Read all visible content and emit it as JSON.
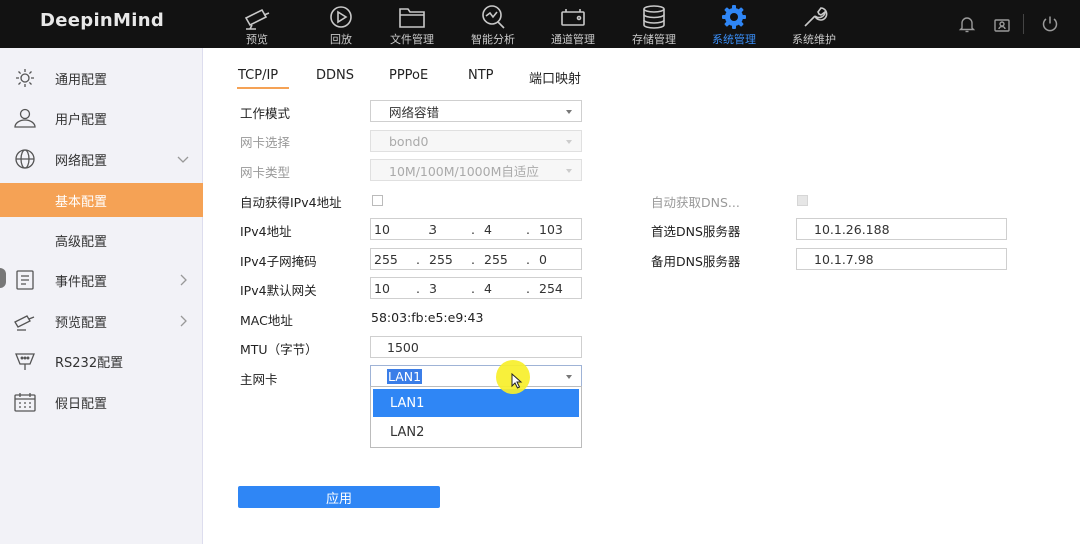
{
  "app": {
    "logo": "DeepinMind"
  },
  "nav": [
    {
      "label": "预览",
      "icon": "camera-icon"
    },
    {
      "label": "回放",
      "icon": "playback-icon"
    },
    {
      "label": "文件管理",
      "icon": "folder-icon"
    },
    {
      "label": "智能分析",
      "icon": "analysis-icon"
    },
    {
      "label": "通道管理",
      "icon": "channel-icon"
    },
    {
      "label": "存储管理",
      "icon": "storage-icon"
    },
    {
      "label": "系统管理",
      "icon": "gear-icon",
      "active": true
    },
    {
      "label": "系统维护",
      "icon": "wrench-icon"
    }
  ],
  "sidebar": {
    "items": [
      {
        "label": "通用配置",
        "icon": "settings-icon"
      },
      {
        "label": "用户配置",
        "icon": "user-icon"
      },
      {
        "label": "网络配置",
        "icon": "globe-icon",
        "expanded": true
      },
      {
        "label": "基本配置",
        "sub": true,
        "active": true
      },
      {
        "label": "高级配置",
        "sub": true
      },
      {
        "label": "事件配置",
        "icon": "event-icon"
      },
      {
        "label": "预览配置",
        "icon": "preview-icon"
      },
      {
        "label": "RS232配置",
        "icon": "serial-icon"
      },
      {
        "label": "假日配置",
        "icon": "calendar-icon"
      }
    ]
  },
  "tabs": [
    {
      "label": "TCP/IP",
      "active": true
    },
    {
      "label": "DDNS"
    },
    {
      "label": "PPPoE"
    },
    {
      "label": "NTP"
    },
    {
      "label": "端口映射"
    }
  ],
  "form": {
    "work_mode_label": "工作模式",
    "work_mode_value": "网络容错",
    "nic_select_label": "网卡选择",
    "nic_select_value": "bond0",
    "nic_type_label": "网卡类型",
    "nic_type_value": "10M/100M/1000M自适应",
    "auto_ipv4_label": "自动获得IPv4地址",
    "ipv4_addr_label": "IPv4地址",
    "ipv4_addr": [
      "10",
      "3",
      "4",
      "103"
    ],
    "ipv4_mask_label": "IPv4子网掩码",
    "ipv4_mask": [
      "255",
      "255",
      "255",
      "0"
    ],
    "ipv4_gw_label": "IPv4默认网关",
    "ipv4_gw": [
      "10",
      "3",
      "4",
      "254"
    ],
    "mac_label": "MAC地址",
    "mac_value": "58:03:fb:e5:e9:43",
    "mtu_label": "MTU（字节）",
    "mtu_value": "1500",
    "main_nic_label": "主网卡",
    "main_nic_value": "LAN1",
    "main_nic_options": [
      "LAN1",
      "LAN2"
    ],
    "auto_dns_label": "自动获取DNS...",
    "pref_dns_label": "首选DNS服务器",
    "pref_dns_value": "10.1.26.188",
    "alt_dns_label": "备用DNS服务器",
    "alt_dns_value": "10.1.7.98",
    "apply_label": "应用",
    "ip_dot": "."
  },
  "colors": {
    "accent": "#f5a255",
    "primary": "#2f86f5",
    "topbar": "#121212",
    "active_nav": "#3a8ef6"
  }
}
